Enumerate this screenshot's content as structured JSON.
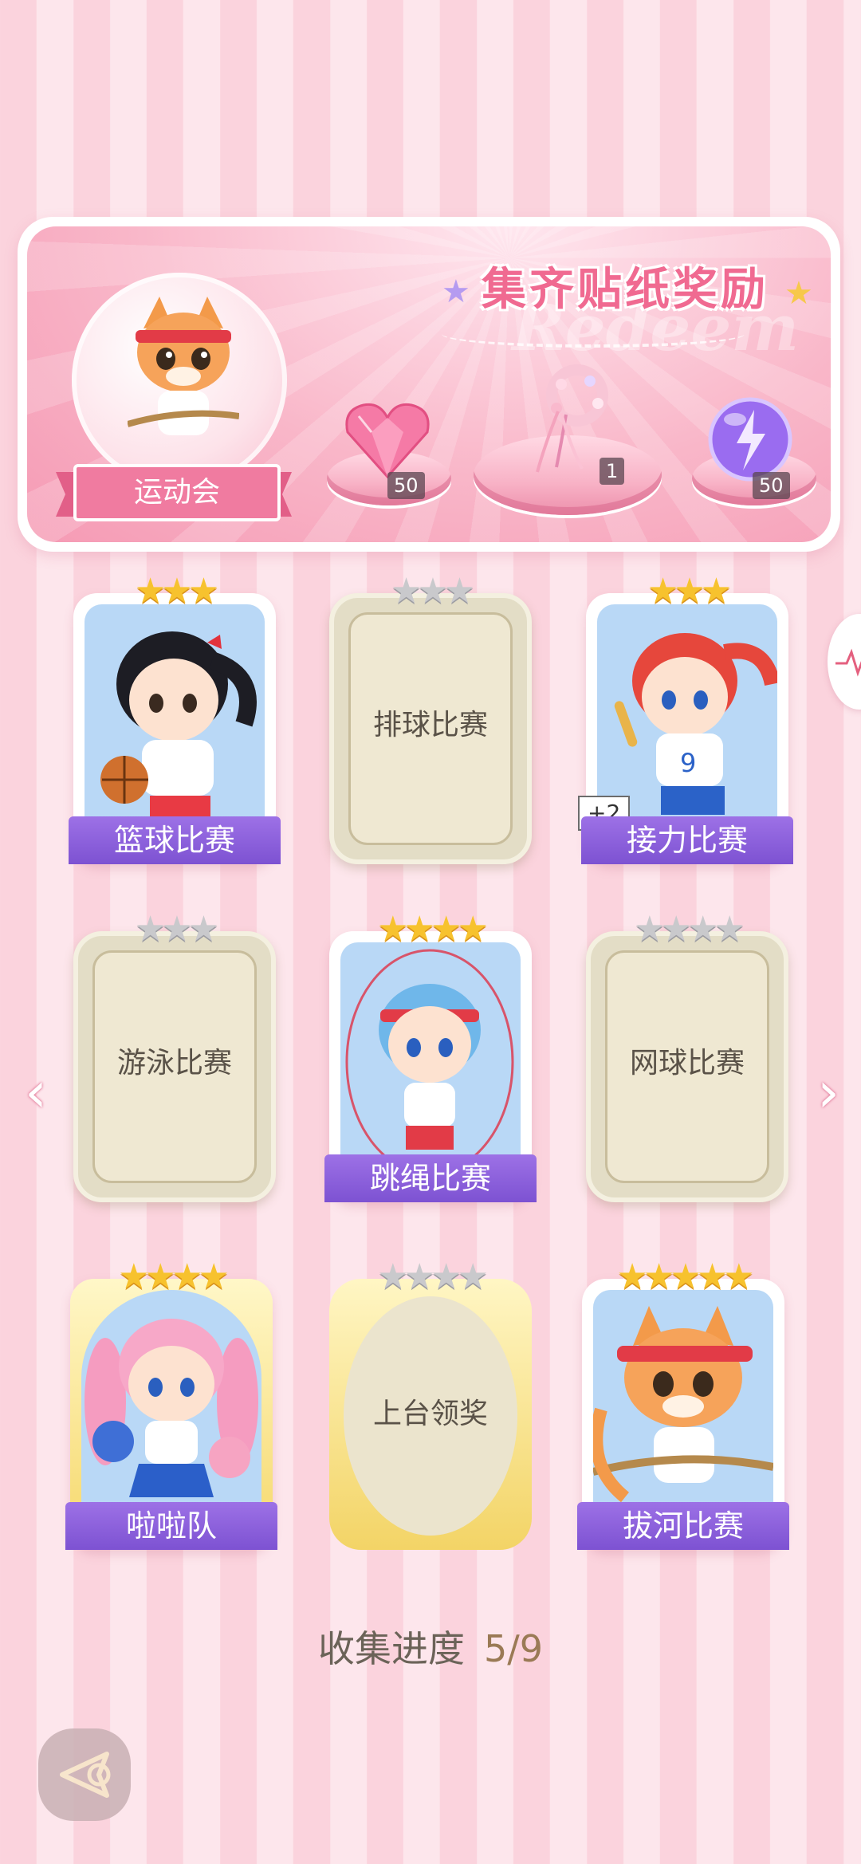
{
  "banner": {
    "title": "集齐贴纸奖励",
    "watermark": "Redeem",
    "event_name": "运动会",
    "rewards": [
      {
        "icon": "pink-heart-gem-icon",
        "count": "50"
      },
      {
        "icon": "ribbon-wreath-icon",
        "count": "1"
      },
      {
        "icon": "purple-energy-orb-icon",
        "count": "50"
      }
    ]
  },
  "cards": [
    {
      "label": "篮球比赛",
      "stars_filled": 3,
      "stars_total": 3,
      "unlocked": true
    },
    {
      "label": "排球比赛",
      "stars_filled": 0,
      "stars_total": 3,
      "unlocked": false
    },
    {
      "label": "接力比赛",
      "stars_filled": 3,
      "stars_total": 3,
      "unlocked": true,
      "badge": "+2"
    },
    {
      "label": "游泳比赛",
      "stars_filled": 0,
      "stars_total": 3,
      "unlocked": false
    },
    {
      "label": "跳绳比赛",
      "stars_filled": 4,
      "stars_total": 4,
      "unlocked": true
    },
    {
      "label": "网球比赛",
      "stars_filled": 0,
      "stars_total": 4,
      "unlocked": false
    },
    {
      "label": "啦啦队",
      "stars_filled": 4,
      "stars_total": 4,
      "unlocked": true
    },
    {
      "label": "上台领奖",
      "stars_filled": 0,
      "stars_total": 4,
      "unlocked": false
    },
    {
      "label": "拔河比赛",
      "stars_filled": 5,
      "stars_total": 5,
      "unlocked": true
    }
  ],
  "progress": {
    "label": "收集进度",
    "value": "5/9",
    "fraction": 0.556
  },
  "nav": {
    "prev": "‹",
    "next": "›"
  },
  "colors": {
    "accent_pink": "#f06a91",
    "label_purple": "#8a5fdc",
    "star_gold": "#f7c22e"
  }
}
